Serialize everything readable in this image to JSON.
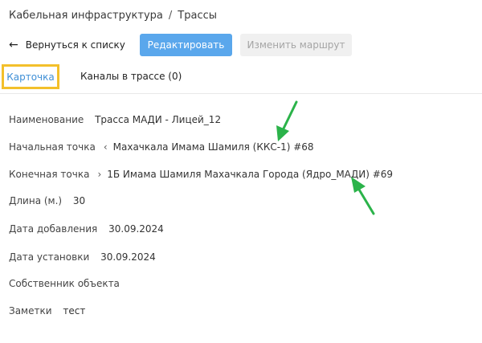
{
  "breadcrumb": {
    "section": "Кабельная инфраструктура",
    "separator": "/",
    "current": "Трассы"
  },
  "toolbar": {
    "back_label": "Вернуться к списку",
    "edit_label": "Редактировать",
    "route_label": "Изменить маршрут"
  },
  "tabs": [
    {
      "label": "Карточка",
      "active": true
    },
    {
      "label": "Каналы в трассе (0)",
      "active": false
    }
  ],
  "fields": {
    "name": {
      "label": "Наименование",
      "value": "Трасса МАДИ - Лицей_12"
    },
    "start": {
      "label": "Начальная точка",
      "value": "Махачкала Имама Шамиля (ККС-1) #68"
    },
    "end": {
      "label": "Конечная точка",
      "value": "1Б Имама Шамиля Махачкала Города (Ядро_МАДИ) #69"
    },
    "length": {
      "label": "Длина (м.)",
      "value": "30"
    },
    "added": {
      "label": "Дата добавления",
      "value": "30.09.2024"
    },
    "installed": {
      "label": "Дата установки",
      "value": "30.09.2024"
    },
    "owner": {
      "label": "Собственник объекта",
      "value": ""
    },
    "notes": {
      "label": "Заметки",
      "value": "тест"
    }
  },
  "colors": {
    "primary": "#5aa7ec",
    "highlight": "#f3c02b",
    "annotation_arrow": "#2bb34a",
    "active_tab": "#3f8fd6"
  },
  "icons": {
    "back": "arrow-left-icon",
    "start_chevron": "chevron-left-icon",
    "end_chevron": "chevron-right-icon",
    "annotation": "green-arrow-icon"
  }
}
